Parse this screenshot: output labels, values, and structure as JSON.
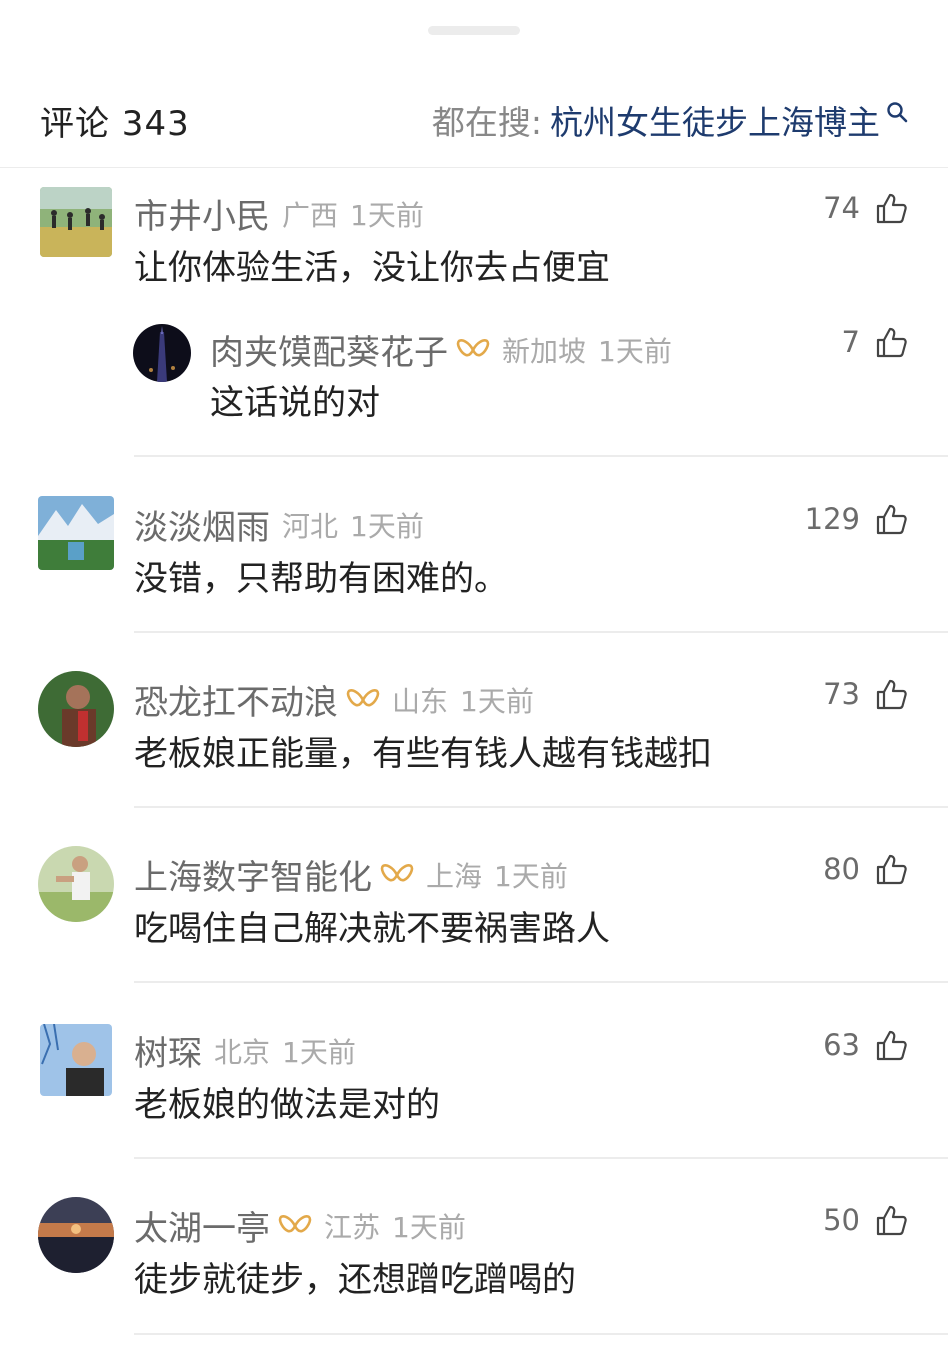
{
  "header": {
    "title": "评论 343",
    "hot_prefix": "都在搜:",
    "hot_query": "杭州女生徒步上海博主",
    "icon": "search-icon"
  },
  "comments": [
    {
      "nick": "市井小民",
      "vip": false,
      "location": "广西",
      "time": "1天前",
      "text": "让你体验生活，没让你去占便宜",
      "likes": "74",
      "reply": {
        "nick": "肉夹馍配葵花子",
        "vip": true,
        "location": "新加坡",
        "time": "1天前",
        "text": "这话说的对",
        "likes": "7"
      }
    },
    {
      "nick": "淡淡烟雨",
      "vip": false,
      "location": "河北",
      "time": "1天前",
      "text": "没错，只帮助有困难的。",
      "likes": "129"
    },
    {
      "nick": "恐龙扛不动浪",
      "vip": true,
      "location": "山东",
      "time": "1天前",
      "text": "老板娘正能量，有些有钱人越有钱越扣",
      "likes": "73"
    },
    {
      "nick": "上海数字智能化",
      "vip": true,
      "location": "上海",
      "time": "1天前",
      "text": "吃喝住自己解决就不要祸害路人",
      "likes": "80"
    },
    {
      "nick": "树琛",
      "vip": false,
      "location": "北京",
      "time": "1天前",
      "text": "老板娘的做法是对的",
      "likes": "63"
    },
    {
      "nick": "太湖一亭",
      "vip": true,
      "location": "江苏",
      "time": "1天前",
      "text": "徒步就徒步，还想蹭吃蹭喝的",
      "likes": "50"
    }
  ],
  "colors": {
    "accent_query": "#1e3b6e",
    "vip_gold": "#e3a94a",
    "meta_gray": "#aaaaaa"
  }
}
